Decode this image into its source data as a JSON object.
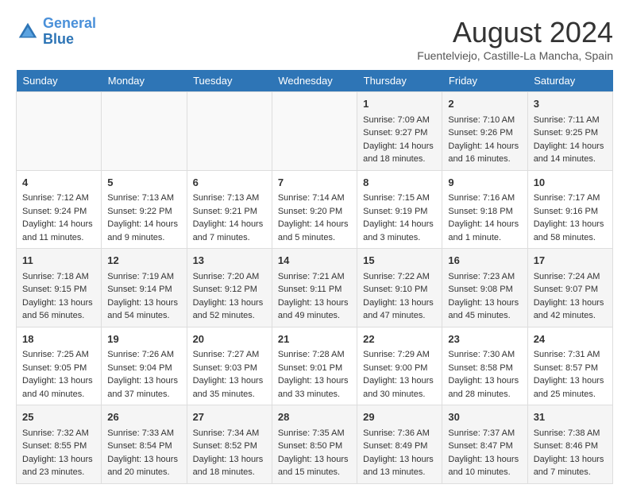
{
  "header": {
    "logo_line1": "General",
    "logo_line2": "Blue",
    "month_year": "August 2024",
    "location": "Fuentelviejo, Castille-La Mancha, Spain"
  },
  "weekdays": [
    "Sunday",
    "Monday",
    "Tuesday",
    "Wednesday",
    "Thursday",
    "Friday",
    "Saturday"
  ],
  "weeks": [
    [
      {
        "day": "",
        "sunrise": "",
        "sunset": "",
        "daylight": ""
      },
      {
        "day": "",
        "sunrise": "",
        "sunset": "",
        "daylight": ""
      },
      {
        "day": "",
        "sunrise": "",
        "sunset": "",
        "daylight": ""
      },
      {
        "day": "",
        "sunrise": "",
        "sunset": "",
        "daylight": ""
      },
      {
        "day": "1",
        "sunrise": "Sunrise: 7:09 AM",
        "sunset": "Sunset: 9:27 PM",
        "daylight": "Daylight: 14 hours and 18 minutes."
      },
      {
        "day": "2",
        "sunrise": "Sunrise: 7:10 AM",
        "sunset": "Sunset: 9:26 PM",
        "daylight": "Daylight: 14 hours and 16 minutes."
      },
      {
        "day": "3",
        "sunrise": "Sunrise: 7:11 AM",
        "sunset": "Sunset: 9:25 PM",
        "daylight": "Daylight: 14 hours and 14 minutes."
      }
    ],
    [
      {
        "day": "4",
        "sunrise": "Sunrise: 7:12 AM",
        "sunset": "Sunset: 9:24 PM",
        "daylight": "Daylight: 14 hours and 11 minutes."
      },
      {
        "day": "5",
        "sunrise": "Sunrise: 7:13 AM",
        "sunset": "Sunset: 9:22 PM",
        "daylight": "Daylight: 14 hours and 9 minutes."
      },
      {
        "day": "6",
        "sunrise": "Sunrise: 7:13 AM",
        "sunset": "Sunset: 9:21 PM",
        "daylight": "Daylight: 14 hours and 7 minutes."
      },
      {
        "day": "7",
        "sunrise": "Sunrise: 7:14 AM",
        "sunset": "Sunset: 9:20 PM",
        "daylight": "Daylight: 14 hours and 5 minutes."
      },
      {
        "day": "8",
        "sunrise": "Sunrise: 7:15 AM",
        "sunset": "Sunset: 9:19 PM",
        "daylight": "Daylight: 14 hours and 3 minutes."
      },
      {
        "day": "9",
        "sunrise": "Sunrise: 7:16 AM",
        "sunset": "Sunset: 9:18 PM",
        "daylight": "Daylight: 14 hours and 1 minute."
      },
      {
        "day": "10",
        "sunrise": "Sunrise: 7:17 AM",
        "sunset": "Sunset: 9:16 PM",
        "daylight": "Daylight: 13 hours and 58 minutes."
      }
    ],
    [
      {
        "day": "11",
        "sunrise": "Sunrise: 7:18 AM",
        "sunset": "Sunset: 9:15 PM",
        "daylight": "Daylight: 13 hours and 56 minutes."
      },
      {
        "day": "12",
        "sunrise": "Sunrise: 7:19 AM",
        "sunset": "Sunset: 9:14 PM",
        "daylight": "Daylight: 13 hours and 54 minutes."
      },
      {
        "day": "13",
        "sunrise": "Sunrise: 7:20 AM",
        "sunset": "Sunset: 9:12 PM",
        "daylight": "Daylight: 13 hours and 52 minutes."
      },
      {
        "day": "14",
        "sunrise": "Sunrise: 7:21 AM",
        "sunset": "Sunset: 9:11 PM",
        "daylight": "Daylight: 13 hours and 49 minutes."
      },
      {
        "day": "15",
        "sunrise": "Sunrise: 7:22 AM",
        "sunset": "Sunset: 9:10 PM",
        "daylight": "Daylight: 13 hours and 47 minutes."
      },
      {
        "day": "16",
        "sunrise": "Sunrise: 7:23 AM",
        "sunset": "Sunset: 9:08 PM",
        "daylight": "Daylight: 13 hours and 45 minutes."
      },
      {
        "day": "17",
        "sunrise": "Sunrise: 7:24 AM",
        "sunset": "Sunset: 9:07 PM",
        "daylight": "Daylight: 13 hours and 42 minutes."
      }
    ],
    [
      {
        "day": "18",
        "sunrise": "Sunrise: 7:25 AM",
        "sunset": "Sunset: 9:05 PM",
        "daylight": "Daylight: 13 hours and 40 minutes."
      },
      {
        "day": "19",
        "sunrise": "Sunrise: 7:26 AM",
        "sunset": "Sunset: 9:04 PM",
        "daylight": "Daylight: 13 hours and 37 minutes."
      },
      {
        "day": "20",
        "sunrise": "Sunrise: 7:27 AM",
        "sunset": "Sunset: 9:03 PM",
        "daylight": "Daylight: 13 hours and 35 minutes."
      },
      {
        "day": "21",
        "sunrise": "Sunrise: 7:28 AM",
        "sunset": "Sunset: 9:01 PM",
        "daylight": "Daylight: 13 hours and 33 minutes."
      },
      {
        "day": "22",
        "sunrise": "Sunrise: 7:29 AM",
        "sunset": "Sunset: 9:00 PM",
        "daylight": "Daylight: 13 hours and 30 minutes."
      },
      {
        "day": "23",
        "sunrise": "Sunrise: 7:30 AM",
        "sunset": "Sunset: 8:58 PM",
        "daylight": "Daylight: 13 hours and 28 minutes."
      },
      {
        "day": "24",
        "sunrise": "Sunrise: 7:31 AM",
        "sunset": "Sunset: 8:57 PM",
        "daylight": "Daylight: 13 hours and 25 minutes."
      }
    ],
    [
      {
        "day": "25",
        "sunrise": "Sunrise: 7:32 AM",
        "sunset": "Sunset: 8:55 PM",
        "daylight": "Daylight: 13 hours and 23 minutes."
      },
      {
        "day": "26",
        "sunrise": "Sunrise: 7:33 AM",
        "sunset": "Sunset: 8:54 PM",
        "daylight": "Daylight: 13 hours and 20 minutes."
      },
      {
        "day": "27",
        "sunrise": "Sunrise: 7:34 AM",
        "sunset": "Sunset: 8:52 PM",
        "daylight": "Daylight: 13 hours and 18 minutes."
      },
      {
        "day": "28",
        "sunrise": "Sunrise: 7:35 AM",
        "sunset": "Sunset: 8:50 PM",
        "daylight": "Daylight: 13 hours and 15 minutes."
      },
      {
        "day": "29",
        "sunrise": "Sunrise: 7:36 AM",
        "sunset": "Sunset: 8:49 PM",
        "daylight": "Daylight: 13 hours and 13 minutes."
      },
      {
        "day": "30",
        "sunrise": "Sunrise: 7:37 AM",
        "sunset": "Sunset: 8:47 PM",
        "daylight": "Daylight: 13 hours and 10 minutes."
      },
      {
        "day": "31",
        "sunrise": "Sunrise: 7:38 AM",
        "sunset": "Sunset: 8:46 PM",
        "daylight": "Daylight: 13 hours and 7 minutes."
      }
    ]
  ]
}
